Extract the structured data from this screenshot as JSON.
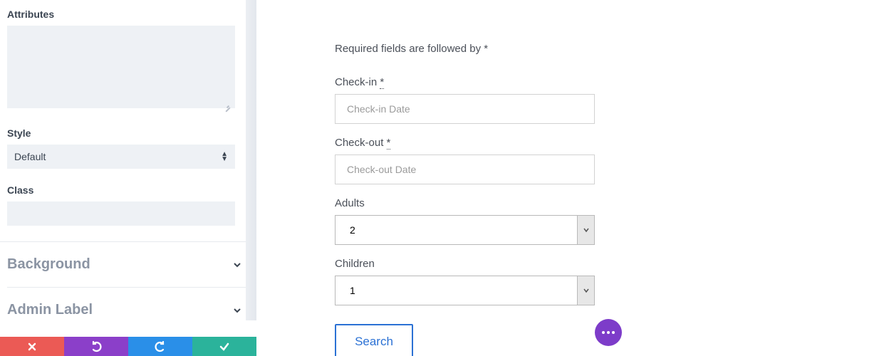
{
  "sidebar": {
    "attributes_heading": "Attributes",
    "attributes_value": "",
    "style_heading": "Style",
    "style_value": "Default",
    "class_heading": "Class",
    "class_value": "",
    "accordion": [
      {
        "label": "Background"
      },
      {
        "label": "Admin Label"
      }
    ]
  },
  "main": {
    "required_note": "Required fields are followed by *",
    "checkin_label": "Check-in ",
    "checkin_required": "*",
    "checkin_placeholder": "Check-in Date",
    "checkin_value": "",
    "checkout_label": "Check-out ",
    "checkout_required": "*",
    "checkout_placeholder": "Check-out Date",
    "checkout_value": "",
    "adults_label": "Adults",
    "adults_value": "2",
    "children_label": "Children",
    "children_value": "1",
    "search_label": "Search"
  }
}
